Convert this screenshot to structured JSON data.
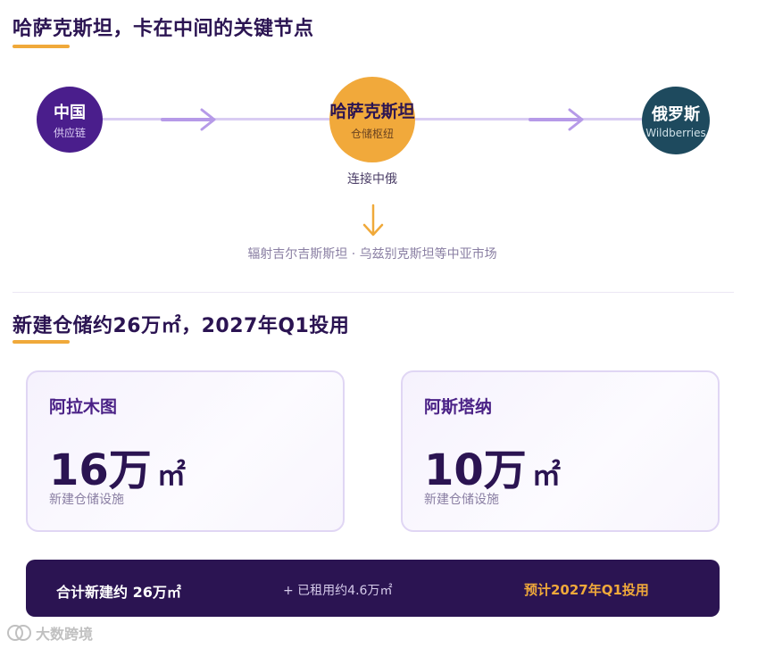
{
  "section1": {
    "title": "哈萨克斯坦，卡在中间的关键节点",
    "nodes": [
      {
        "title": "中国",
        "subtitle": "供应链"
      },
      {
        "title": "哈萨克斯坦",
        "subtitle": "仓储枢纽"
      },
      {
        "title": "俄罗斯",
        "subtitle": "Wildberries"
      }
    ],
    "hub_caption": "连接中俄",
    "radiate_caption": "辐射吉尔吉斯斯坦 · 乌兹别克斯坦等中亚市场"
  },
  "section2": {
    "title": "新建仓储约26万㎡，2027年Q1投用",
    "cards": [
      {
        "city": "阿拉木图",
        "value": "16万",
        "unit": "㎡",
        "desc": "新建仓储设施"
      },
      {
        "city": "阿斯塔纳",
        "value": "10万",
        "unit": "㎡",
        "desc": "新建仓储设施"
      }
    ],
    "summary": {
      "left": "合计新建约 26万㎡",
      "middle": "+ 已租用约4.6万㎡",
      "right": "预计2027年Q1投用"
    }
  },
  "watermark": "大数跨境",
  "colors": {
    "china": "#4a1e8c",
    "kazakhstan": "#f1a93b",
    "russia": "#1e4a5e",
    "accent": "#f0a93a",
    "dark": "#2b1452",
    "arrow": "#b69ae8"
  }
}
